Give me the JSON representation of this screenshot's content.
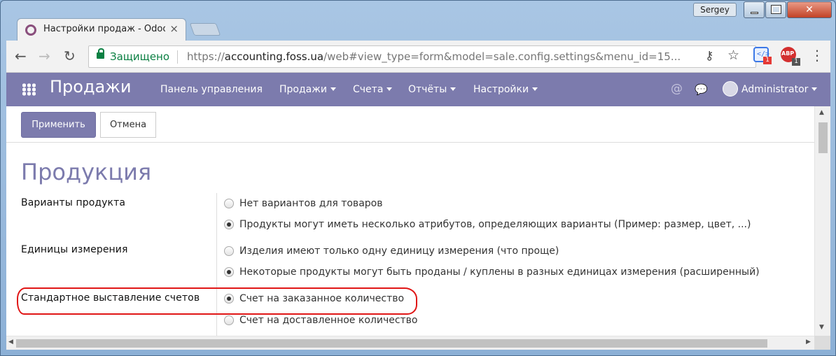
{
  "window": {
    "user": "Sergey"
  },
  "tab": {
    "title": "Настройки продаж - Odoo",
    "close_glyph": "×"
  },
  "address_bar": {
    "secure_label": "Защищено",
    "url_scheme": "https://",
    "url_host": "accounting.foss.ua",
    "url_rest": "/web#view_type=form&model=sale.config.settings&menu_id=15...",
    "back_glyph": "←",
    "forward_glyph": "→",
    "reload_glyph": "↻",
    "key_glyph": "⚷",
    "star_glyph": "☆"
  },
  "extensions": [
    {
      "name": "code-extension",
      "badge": "1",
      "badge_color": "#e53935"
    },
    {
      "name": "adblock-extension",
      "label": "ABP",
      "badge": "1",
      "badge_color": "#555555"
    }
  ],
  "menu_glyph": "⋮",
  "navbar": {
    "brand": "Продажи",
    "menu": [
      "Панель управления",
      "Продажи",
      "Счета",
      "Отчёты",
      "Настройки"
    ],
    "at_glyph": "@",
    "chat_glyph": "💬",
    "user": "Administrator"
  },
  "control_panel": {
    "apply_label": "Применить",
    "cancel_label": "Отмена"
  },
  "section": {
    "title": "Продукция",
    "settings": [
      {
        "label": "Варианты продукта",
        "options": [
          {
            "text": "Нет вариантов для товаров",
            "selected": false
          },
          {
            "text": "Продукты могут иметь несколько атрибутов, определяющих варианты (Пример: размер, цвет, ...)",
            "selected": true
          }
        ]
      },
      {
        "label": "Единицы измерения",
        "options": [
          {
            "text": "Изделия имеют только одну единицу измерения (что проще)",
            "selected": false
          },
          {
            "text": "Некоторые продукты могут быть проданы / куплены в разных единицах измерения (расширенный)",
            "selected": true
          }
        ]
      },
      {
        "label": "Стандартное выставление счетов",
        "options": [
          {
            "text": "Счет на заказанное количество",
            "selected": true
          },
          {
            "text": "Счет на доставленное количество",
            "selected": false
          }
        ]
      }
    ]
  },
  "colors": {
    "brand": "#7c7bad",
    "annotation": "#e01616",
    "secure": "#0b8043"
  }
}
